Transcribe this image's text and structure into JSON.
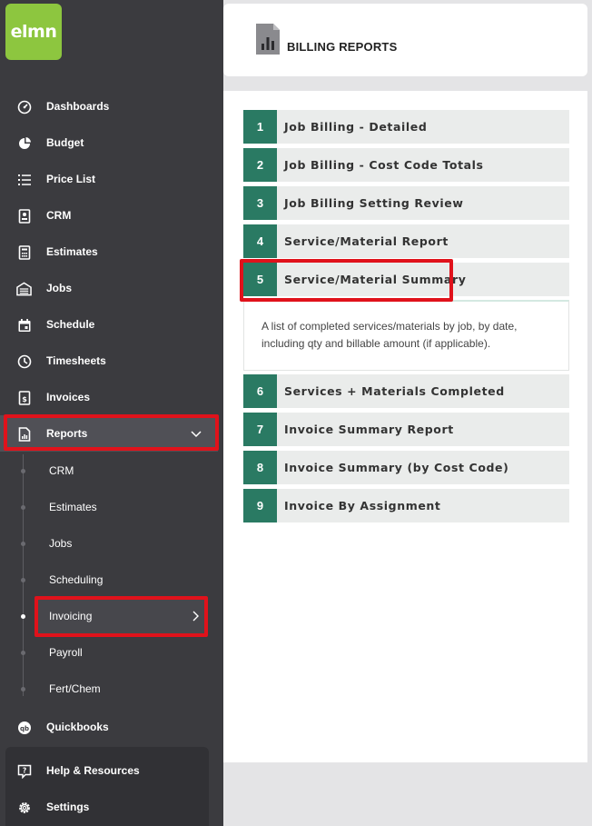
{
  "brand": {
    "logo_text": "elmn",
    "logo_color": "#8dc63f"
  },
  "sidebar": {
    "items": [
      {
        "label": "Dashboards",
        "icon": "gauge-icon"
      },
      {
        "label": "Budget",
        "icon": "pie-chart-icon"
      },
      {
        "label": "Price List",
        "icon": "list-icon"
      },
      {
        "label": "CRM",
        "icon": "contact-card-icon"
      },
      {
        "label": "Estimates",
        "icon": "calculator-icon"
      },
      {
        "label": "Jobs",
        "icon": "warehouse-icon"
      },
      {
        "label": "Schedule",
        "icon": "calendar-icon"
      },
      {
        "label": "Timesheets",
        "icon": "clock-icon"
      },
      {
        "label": "Invoices",
        "icon": "invoice-icon"
      },
      {
        "label": "Reports",
        "icon": "report-icon"
      }
    ],
    "report_subitems": [
      {
        "label": "CRM"
      },
      {
        "label": "Estimates"
      },
      {
        "label": "Jobs"
      },
      {
        "label": "Scheduling"
      },
      {
        "label": "Invoicing"
      },
      {
        "label": "Payroll"
      },
      {
        "label": "Fert/Chem"
      }
    ],
    "quickbooks": {
      "label": "Quickbooks",
      "icon": "quickbooks-icon"
    },
    "bottom": [
      {
        "label": "Help & Resources",
        "icon": "help-icon"
      },
      {
        "label": "Settings",
        "icon": "gear-icon"
      }
    ]
  },
  "header": {
    "title": "BILLING REPORTS",
    "icon": "report-document-icon"
  },
  "reports": [
    {
      "num": "1",
      "label": "Job Billing - Detailed"
    },
    {
      "num": "2",
      "label": "Job Billing - Cost Code Totals"
    },
    {
      "num": "3",
      "label": "Job Billing Setting Review"
    },
    {
      "num": "4",
      "label": "Service/Material Report"
    },
    {
      "num": "5",
      "label": "Service/Material Summary",
      "expanded": true,
      "description": "A list of completed services/materials by job, by date, including qty and billable amount (if applicable)."
    },
    {
      "num": "6",
      "label": "Services + Materials Completed"
    },
    {
      "num": "7",
      "label": "Invoice Summary Report"
    },
    {
      "num": "8",
      "label": "Invoice Summary (by Cost Code)"
    },
    {
      "num": "9",
      "label": "Invoice By Assignment"
    }
  ],
  "colors": {
    "accent_green": "#2a7a63",
    "highlight_red": "#e0121b",
    "sidebar_bg": "#3b3b3f"
  }
}
